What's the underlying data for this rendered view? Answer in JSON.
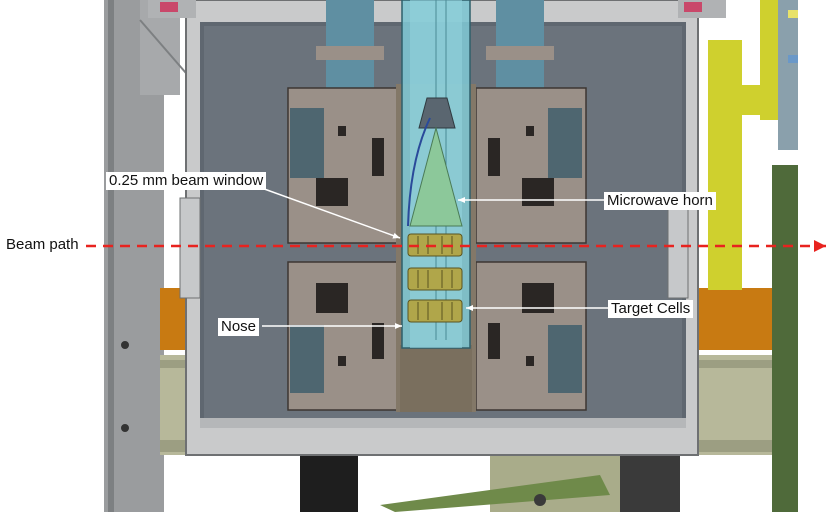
{
  "labels": {
    "beam_window": "0.25 mm beam window",
    "microwave_horn": "Microwave horn",
    "beam_path": "Beam path",
    "target_cells": "Target Cells",
    "nose": "Nose"
  },
  "colors": {
    "background": "#ffffff",
    "vessel_inner": "#5f6770",
    "frame_grey": "#9a9c9e",
    "magnet_block": "#9a9088",
    "insert_tube": "#7ec4d0",
    "horn_green": "#8cc89a",
    "target_cell": "#b0a64a",
    "beam_line": "#e8231f",
    "orange_support": "#c87a12",
    "yellow_strut": "#cfd02e",
    "green_plate": "#4f6a3a"
  }
}
